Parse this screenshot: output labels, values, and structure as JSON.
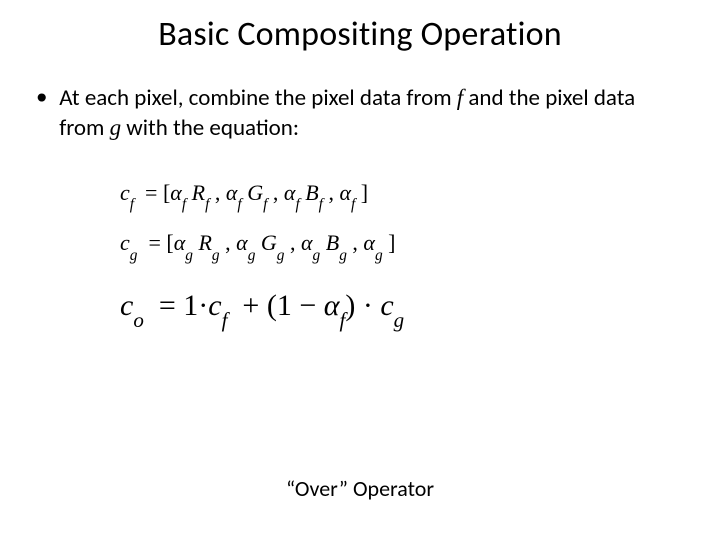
{
  "title": "Basic Compositing Operation",
  "bullet": {
    "pre": "At each pixel, combine the pixel data from ",
    "var1": "f",
    "mid": " and the pixel data from ",
    "var2": "g",
    "post": " with the equation:"
  },
  "eq1": {
    "lhs": "c",
    "lhs_sub": "f",
    "body": " = [α_f R_f , α_f G_f , α_f B_f , α_f ]"
  },
  "eq2": {
    "lhs": "c",
    "lhs_sub": "g",
    "body": " = [α_g R_g , α_g G_g , α_g B_g , α_g ]"
  },
  "eq3": {
    "lhs": "c",
    "lhs_sub": "o",
    "one": "1",
    "cf": "c",
    "cf_sub": "f",
    "cg": "c",
    "cg_sub": "g",
    "alpha_sub": "f"
  },
  "caption": "“Over” Operator"
}
